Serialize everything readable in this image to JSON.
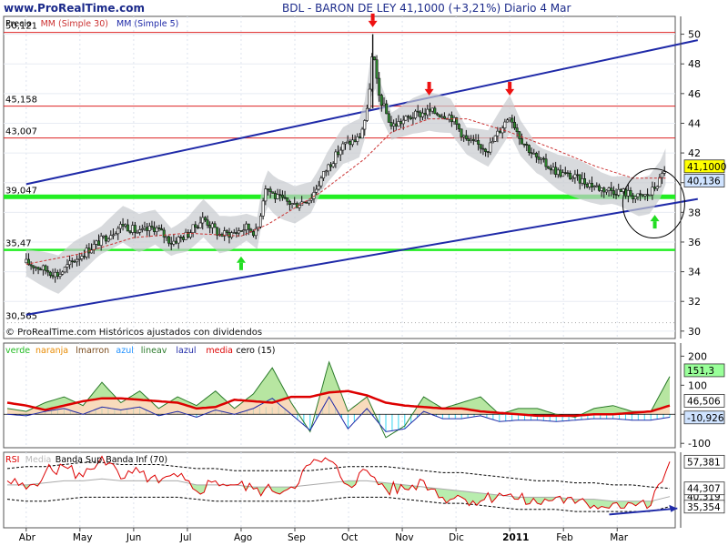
{
  "header": {
    "site": "www.ProRealTime.com",
    "title": "BDL - BARON DE LEY    41,1000 (+3,21%)    Diario  4 Mar",
    "copyright": "© ProRealTime.com Históricos ajustados con dividendos"
  },
  "legends": {
    "price": [
      {
        "text": "Precio",
        "color": "#000000"
      },
      {
        "text": "MM (Simple 30)",
        "color": "#cc3333"
      },
      {
        "text": "MM (Simple 5)",
        "color": "#1f2aa8"
      }
    ],
    "macd": [
      {
        "text": "verde",
        "color": "#22bb22"
      },
      {
        "text": "naranja",
        "color": "#e88a00"
      },
      {
        "text": "lmarron",
        "color": "#7a4a1a"
      },
      {
        "text": "azul",
        "color": "#1e90ff"
      },
      {
        "text": "lineav",
        "color": "#2a7a2a"
      },
      {
        "text": "lazul",
        "color": "#1f2aa8"
      },
      {
        "text": "media",
        "color": "#dd0000"
      },
      {
        "text": "cero (15)",
        "color": "#000000"
      }
    ],
    "rsi": [
      {
        "text": "RSI",
        "color": "#dd0000"
      },
      {
        "text": "Media",
        "color": "#bbbbbb"
      },
      {
        "text": "Banda Sup",
        "color": "#000000"
      },
      {
        "text": "Banda Inf (70)",
        "color": "#000000"
      }
    ]
  },
  "colors": {
    "resistance": "#dd2222",
    "support": "#22ee22",
    "channel": "#1f2aa8",
    "arrow_down": "#ee1111",
    "arrow_up": "#22dd22",
    "price_badge": "#ffff00",
    "ma5_badge": "#cfe3ff",
    "macd_green_badge": "#99ff99",
    "panel_bg": "#ffffff"
  },
  "chart_data": [
    {
      "type": "candlestick",
      "title": "BDL - BARON DE LEY",
      "ylim": [
        29.5,
        51.2
      ],
      "y_ticks": [
        30,
        32,
        34,
        36,
        38,
        40,
        42,
        44,
        46,
        48,
        50
      ],
      "x_ticks": [
        "Abr",
        "May",
        "Jun",
        "Jul",
        "Ago",
        "Sep",
        "Oct",
        "Nov",
        "Dic",
        "2011",
        "Feb",
        "Mar"
      ],
      "hlines": [
        {
          "value": 50.121,
          "label": "50,121",
          "color": "#dd2222"
        },
        {
          "value": 45.158,
          "label": "45,158",
          "color": "#dd2222"
        },
        {
          "value": 43.007,
          "label": "43,007",
          "color": "#dd2222"
        },
        {
          "value": 39.047,
          "label": "39,047",
          "color": "#22ee22"
        },
        {
          "value": 35.47,
          "label": "35,47",
          "color": "#22ee22"
        },
        {
          "value": 30.565,
          "label": "30,565",
          "color": "#aaaaaa"
        }
      ],
      "trendlines": [
        {
          "from": {
            "month": 0,
            "value": 39.9
          },
          "to": {
            "month": 12.5,
            "value": 49.6
          },
          "color": "#1f2aa8"
        },
        {
          "from": {
            "month": 0,
            "value": 31.1
          },
          "to": {
            "month": 12.5,
            "value": 38.9
          },
          "color": "#1f2aa8"
        }
      ],
      "markers": [
        {
          "type": "down",
          "month": 6.45,
          "value": 50.9
        },
        {
          "type": "down",
          "month": 7.5,
          "value": 46.3
        },
        {
          "type": "down",
          "month": 9.0,
          "value": 46.3
        },
        {
          "type": "up",
          "month": 4.0,
          "value": 34.6
        },
        {
          "type": "up",
          "month": 11.7,
          "value": 37.4
        }
      ],
      "circle": {
        "month": 11.68,
        "value": 38.6
      },
      "close_path": [
        [
          0,
          34.6
        ],
        [
          0.3,
          34.2
        ],
        [
          0.6,
          33.8
        ],
        [
          0.9,
          34.8
        ],
        [
          1.2,
          35.6
        ],
        [
          1.5,
          36.4
        ],
        [
          1.8,
          37.2
        ],
        [
          2.1,
          36.6
        ],
        [
          2.4,
          37.0
        ],
        [
          2.7,
          36.0
        ],
        [
          3.0,
          36.5
        ],
        [
          3.3,
          37.6
        ],
        [
          3.6,
          36.5
        ],
        [
          3.85,
          36.6
        ],
        [
          4.1,
          37.0
        ],
        [
          4.3,
          36.6
        ],
        [
          4.45,
          39.8
        ],
        [
          4.65,
          39.0
        ],
        [
          5.0,
          38.5
        ],
        [
          5.3,
          39.0
        ],
        [
          5.6,
          41.0
        ],
        [
          5.9,
          42.5
        ],
        [
          6.2,
          43.0
        ],
        [
          6.35,
          44.8
        ],
        [
          6.45,
          49.0
        ],
        [
          6.55,
          46.0
        ],
        [
          6.8,
          43.8
        ],
        [
          7.2,
          44.5
        ],
        [
          7.5,
          44.8
        ],
        [
          7.9,
          44.5
        ],
        [
          8.2,
          42.8
        ],
        [
          8.6,
          42.3
        ],
        [
          9.0,
          44.6
        ],
        [
          9.2,
          43.0
        ],
        [
          9.5,
          41.6
        ],
        [
          9.9,
          40.7
        ],
        [
          10.3,
          40.2
        ],
        [
          10.7,
          39.6
        ],
        [
          11.1,
          39.4
        ],
        [
          11.4,
          39.0
        ],
        [
          11.6,
          39.2
        ],
        [
          11.8,
          40.2
        ],
        [
          11.9,
          41.1
        ]
      ],
      "ma30_path": [
        [
          0,
          34.5
        ],
        [
          1.0,
          35.2
        ],
        [
          2.0,
          36.3
        ],
        [
          3.0,
          36.6
        ],
        [
          4.0,
          36.4
        ],
        [
          4.5,
          37.2
        ],
        [
          5.5,
          39.4
        ],
        [
          6.3,
          41.6
        ],
        [
          6.8,
          43.4
        ],
        [
          7.5,
          44.3
        ],
        [
          8.2,
          44.3
        ],
        [
          9.0,
          43.4
        ],
        [
          9.8,
          42.3
        ],
        [
          10.6,
          41.1
        ],
        [
          11.3,
          40.3
        ],
        [
          11.9,
          40.3
        ]
      ],
      "last_values": [
        {
          "value": 41.1,
          "label": "41,1000",
          "color": "#ffff00"
        },
        {
          "value": 40.136,
          "label": "40,136",
          "color": "#cfe3ff"
        }
      ]
    },
    {
      "type": "line",
      "title": "",
      "ylim": [
        -115,
        245
      ],
      "y_ticks": [
        200,
        100,
        0,
        -100
      ],
      "series": [
        {
          "name": "verde",
          "values": [
            20,
            10,
            40,
            60,
            30,
            110,
            40,
            80,
            20,
            60,
            30,
            80,
            20,
            70,
            160,
            40,
            -60,
            180,
            10,
            60,
            -80,
            -40,
            60,
            20,
            40,
            60,
            0,
            20,
            20,
            0,
            -10,
            20,
            30,
            10,
            10,
            130
          ]
        },
        {
          "name": "media",
          "values": [
            40,
            30,
            15,
            30,
            45,
            55,
            55,
            50,
            45,
            40,
            20,
            25,
            50,
            45,
            40,
            60,
            60,
            75,
            80,
            65,
            40,
            30,
            25,
            20,
            20,
            10,
            5,
            0,
            -5,
            -5,
            -5,
            0,
            0,
            5,
            10,
            30
          ]
        },
        {
          "name": "lazul",
          "values": [
            0,
            -5,
            10,
            20,
            0,
            25,
            15,
            25,
            -5,
            10,
            -10,
            15,
            0,
            20,
            55,
            0,
            -55,
            60,
            -50,
            20,
            -60,
            -50,
            10,
            -15,
            -15,
            -5,
            -25,
            -20,
            -20,
            -25,
            -20,
            -15,
            -15,
            -20,
            -20,
            -10
          ]
        }
      ],
      "last_values": [
        {
          "value": 151.3,
          "label": "151,3",
          "color": "#99ff99"
        },
        {
          "value": 46.506,
          "label": "46,506",
          "color": "#ffffff"
        },
        {
          "value": -10.926,
          "label": "-10,926",
          "color": "#cfe3ff"
        }
      ]
    },
    {
      "type": "line",
      "title": "",
      "ylim": [
        25,
        62
      ],
      "y_ticks": [
        57.381,
        40.319,
        44.307,
        35.354
      ],
      "series": [
        {
          "name": "RSI",
          "values": [
            48,
            44,
            52,
            55,
            50,
            60,
            49,
            52,
            47,
            50,
            43,
            48,
            46,
            44,
            43,
            45,
            56,
            58,
            46,
            53,
            44,
            44,
            48,
            40,
            40,
            38,
            42,
            39,
            37,
            40,
            37,
            36,
            37,
            37,
            36,
            57.4
          ]
        },
        {
          "name": "Media",
          "values": [
            46,
            46,
            47,
            48,
            48,
            49,
            48,
            48,
            48,
            48,
            46,
            46,
            46,
            45,
            45,
            45,
            46,
            47,
            48,
            48,
            47,
            46,
            45,
            44,
            43,
            42,
            41,
            40,
            40,
            40,
            39,
            39,
            38,
            38,
            38,
            40.3
          ]
        },
        {
          "name": "Banda Sup",
          "values": [
            54,
            55,
            55,
            56,
            57,
            57,
            56,
            56,
            56,
            55,
            54,
            54,
            53,
            53,
            53,
            53,
            53,
            54,
            55,
            55,
            55,
            54,
            53,
            52,
            52,
            51,
            50,
            49,
            48,
            48,
            47,
            47,
            46,
            46,
            45,
            44.3
          ]
        },
        {
          "name": "Banda Inf",
          "values": [
            39,
            38,
            38,
            39,
            40,
            40,
            40,
            40,
            40,
            40,
            39,
            38,
            38,
            38,
            38,
            38,
            38,
            39,
            40,
            40,
            40,
            39,
            38,
            37,
            37,
            36,
            35,
            34,
            34,
            34,
            33,
            33,
            33,
            33,
            33,
            35.4
          ]
        }
      ],
      "last_values": [
        {
          "value": 57.381,
          "label": "57,381",
          "color": "#ffffff"
        },
        {
          "value": 40.319,
          "label": "40,319",
          "color": "#ffffff"
        },
        {
          "value": 44.307,
          "label": "44,307",
          "color": "#ffffff"
        },
        {
          "value": 35.354,
          "label": "35,354",
          "color": "#ffffff"
        }
      ]
    }
  ]
}
